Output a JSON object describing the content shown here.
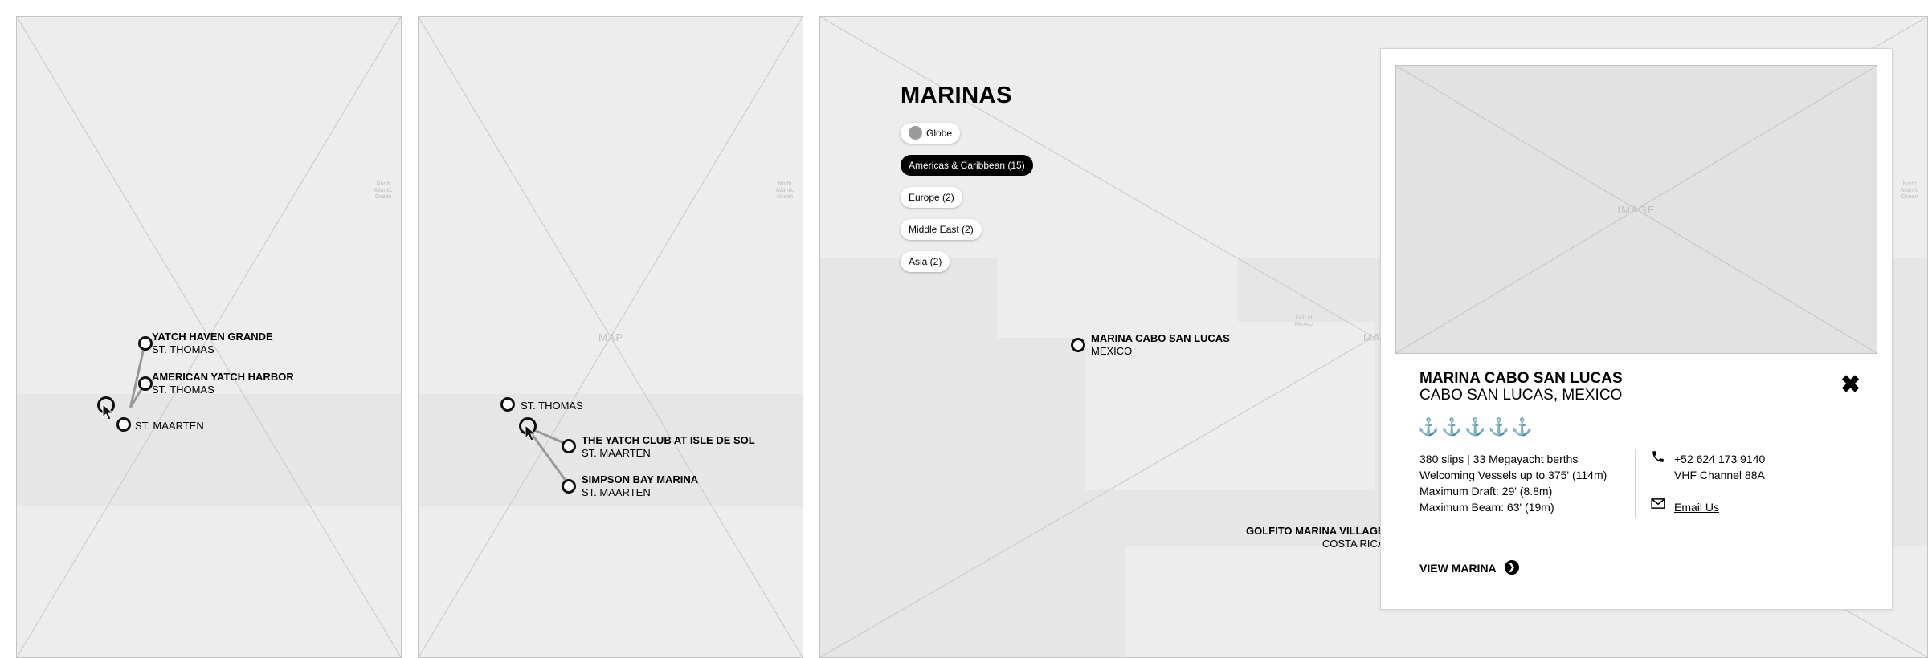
{
  "panel1": {
    "placeholder": "",
    "ocean_label": "North\nAtlantic\nOcean",
    "markers": [
      {
        "name": "YATCH HAVEN GRANDE",
        "location": "ST. THOMAS"
      },
      {
        "name": "AMERICAN YATCH HARBOR",
        "location": "ST. THOMAS"
      },
      {
        "name": "",
        "location": "ST. MAARTEN"
      }
    ]
  },
  "panel2": {
    "placeholder": "MAP",
    "ocean_label": "North\nAtlantic\nOcean",
    "markers": [
      {
        "name": "",
        "location": "ST. THOMAS"
      },
      {
        "name": "THE YATCH CLUB AT ISLE DE SOL",
        "location": "ST. MAARTEN"
      },
      {
        "name": "SIMPSON BAY MARINA",
        "location": "ST. MAARTEN"
      }
    ]
  },
  "panel3": {
    "title": "MARINAS",
    "placeholder": "MAP",
    "ocean_label": "North\nAtlantic\nOcean",
    "gulf_label": "Gulf of\nMexico",
    "regions": [
      {
        "label": "Globe",
        "active": false
      },
      {
        "label": "Americas & Caribbean (15)",
        "active": true
      },
      {
        "label": "Europe (2)",
        "active": false
      },
      {
        "label": "Middle East (2)",
        "active": false
      },
      {
        "label": "Asia (2)",
        "active": false
      }
    ],
    "markers": [
      {
        "name": "MARINA CABO SAN LUCAS",
        "location": "MEXICO"
      },
      {
        "name": "GOLFITO MARINA VILLAGE",
        "location": "COSTA RICA"
      }
    ]
  },
  "card": {
    "image_placeholder": "IMAGE",
    "name": "MARINA CABO SAN LUCAS",
    "place": "CABO SAN LUCAS, MEXICO",
    "rating_icons": "⚓⚓⚓⚓⚓",
    "specs": [
      "380 slips | 33 Megayacht berths",
      "Welcoming Vessels up to 375'  (114m)",
      "Maximum Draft: 29'  (8.8m)",
      "Maximum Beam: 63'  (19m)"
    ],
    "phone": "+52 624 173 9140",
    "vhf": "VHF Channel 88A",
    "email_label": "Email Us",
    "view_label": "VIEW MARINA",
    "close_label": "✖",
    "icons": {
      "phone": "phone-icon",
      "email": "envelope-icon",
      "close": "close-icon",
      "rating": "anchor-icon"
    }
  }
}
